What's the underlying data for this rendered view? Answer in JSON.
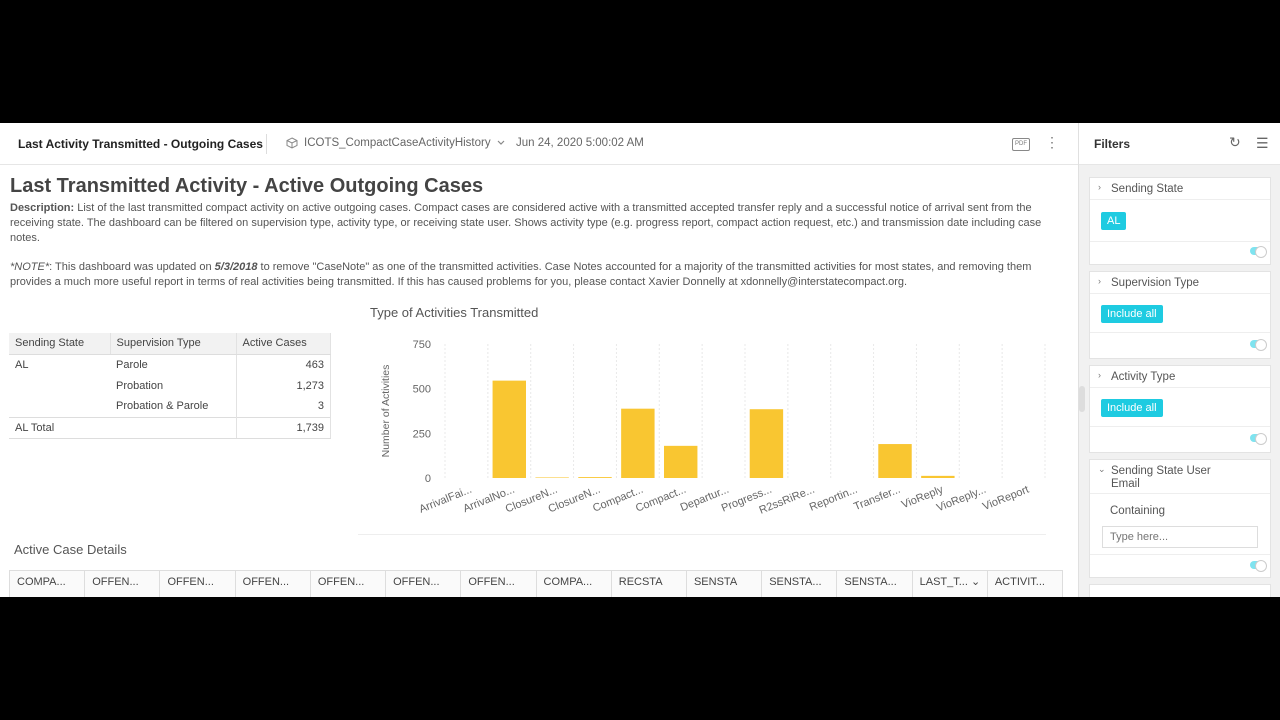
{
  "topbar": {
    "title": "Last Activity Transmitted - Outgoing Cases",
    "dataset": "ICOTS_CompactCaseActivityHistory",
    "date": "Jun 24, 2020 5:00:02 AM",
    "pdf_label": "PDF",
    "icons": [
      "dataset-icon",
      "chevron-down-icon",
      "pdf-icon",
      "more-icon"
    ]
  },
  "main": {
    "heading": "Last Transmitted Activity - Active Outgoing Cases",
    "description_label": "Description:",
    "description_text": " List of the last transmitted compact activity on active outgoing cases. Compact cases are considered active with a transmitted accepted transfer reply and a successful notice of arrival sent from the receiving state. The dashboard can be filtered on supervision type, activity type, or receiving state user.  Shows activity type (e.g. progress report, compact action request, etc.) and transmission date including case notes.",
    "note_label": "*NOTE*",
    "note_pre": ": This dashboard was updated on ",
    "note_date": "5/3/2018",
    "note_post": " to remove \"CaseNote\" as one of the transmitted activities. Case Notes accounted for a majority of the transmitted activities for most states, and removing them provides a much more useful report in terms of real activities being transmitted. If this has caused problems for you, please contact Xavier Donnelly at xdonnelly@interstatecompact.org."
  },
  "pivot": {
    "headers": [
      "Sending State",
      "Supervision Type",
      "Active Cases"
    ],
    "rows": [
      {
        "state": "AL",
        "type": "Parole",
        "cases": "463"
      },
      {
        "state": "",
        "type": "Probation",
        "cases": "1,273"
      },
      {
        "state": "",
        "type": "Probation & Parole",
        "cases": "3"
      }
    ],
    "total_label": "AL Total",
    "total_value": "1,739"
  },
  "chart_data": {
    "type": "bar",
    "title": "Type of Activities Transmitted",
    "ylabel": "Number of Activities",
    "xlabel": "",
    "ylim": [
      0,
      750
    ],
    "yticks": [
      0,
      250,
      500,
      750
    ],
    "categories": [
      "ArrivalFai...",
      "ArrivalNo...",
      "ClosureN...",
      "ClosureN...",
      "Compact...",
      "Compact...",
      "Departur...",
      "Progress...",
      "R2ssRiRe...",
      "Reportin...",
      "Transfer...",
      "VioReply",
      "VioReply...",
      "VioReport"
    ],
    "values": [
      0,
      545,
      3,
      5,
      388,
      180,
      0,
      385,
      0,
      0,
      190,
      12,
      0,
      0
    ],
    "grid": true,
    "bar_color": "#f9c631"
  },
  "details": {
    "title": "Active Case Details",
    "columns": [
      "COMPA...",
      "OFFEN...",
      "OFFEN...",
      "OFFEN...",
      "OFFEN...",
      "OFFEN...",
      "OFFEN...",
      "COMPA...",
      "RECSTA",
      "SENSTA",
      "SENSTA...",
      "SENSTA...",
      "LAST_T...",
      "ACTIVIT..."
    ]
  },
  "filters": {
    "title": "Filters",
    "cards": [
      {
        "label": "Sending State",
        "chip": "AL"
      },
      {
        "label": "Supervision Type",
        "chip": "Include all"
      },
      {
        "label": "Activity Type",
        "chip": "Include all"
      },
      {
        "label": "Sending State User Email",
        "containing": "Containing",
        "placeholder": "Type here..."
      }
    ],
    "accent": "#1ecbe1"
  }
}
